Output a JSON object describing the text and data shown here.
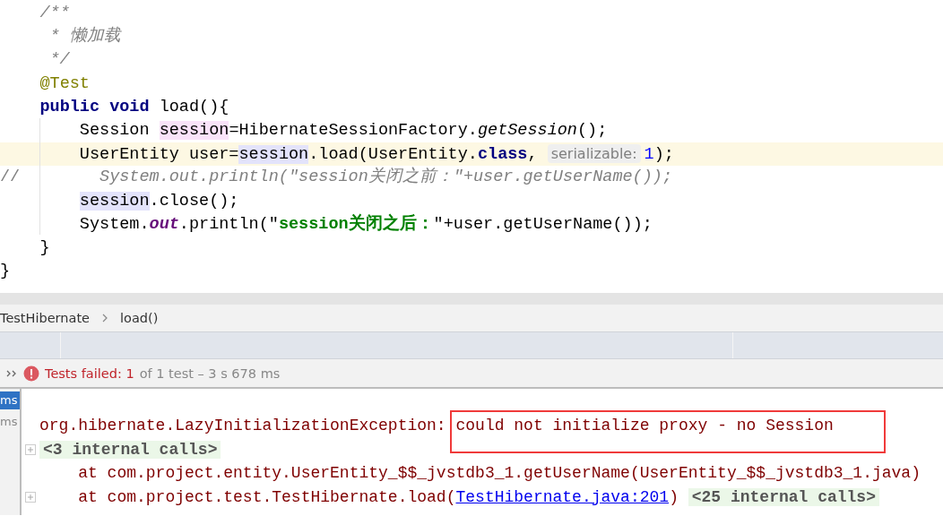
{
  "editor": {
    "lines": [
      {
        "current": false,
        "tokens": [
          {
            "kind": "comment",
            "text": "    /**"
          }
        ]
      },
      {
        "current": false,
        "tokens": [
          {
            "kind": "comment",
            "text": "     * 懒加载"
          }
        ]
      },
      {
        "current": false,
        "tokens": [
          {
            "kind": "comment",
            "text": "     */"
          }
        ]
      },
      {
        "current": false,
        "tokens": [
          {
            "kind": "annotation",
            "text": "    @Test"
          }
        ]
      },
      {
        "current": false,
        "tokens": [
          {
            "kind": "keyword",
            "text": "    public void"
          },
          {
            "kind": "plain",
            "text": " load(){"
          }
        ]
      },
      {
        "current": false,
        "tokens": [
          {
            "kind": "plain",
            "text": "        Session "
          },
          {
            "kind": "write",
            "text": "session"
          },
          {
            "kind": "plain",
            "text": "=HibernateSessionFactory."
          },
          {
            "kind": "static",
            "text": "getSession"
          },
          {
            "kind": "plain",
            "text": "();"
          }
        ]
      },
      {
        "current": true,
        "tokens": [
          {
            "kind": "plain",
            "text": "        UserEntity user="
          },
          {
            "kind": "read",
            "text": "session"
          },
          {
            "kind": "plain",
            "text": ".load(UserEntity."
          },
          {
            "kind": "keyword",
            "text": "class"
          },
          {
            "kind": "plain",
            "text": ", "
          },
          {
            "kind": "hint",
            "text": "serializable:"
          },
          {
            "kind": "number",
            "text": "1"
          },
          {
            "kind": "plain",
            "text": ");"
          }
        ]
      },
      {
        "current": false,
        "tokens": [
          {
            "kind": "comment-plain",
            "text": "//        "
          },
          {
            "kind": "comment",
            "text": "System.out.println(\"session关闭之前：\"+user.getUserName());"
          }
        ]
      },
      {
        "current": false,
        "tokens": [
          {
            "kind": "read",
            "text": "        session"
          },
          {
            "kind": "plain",
            "text": ".close();"
          }
        ]
      },
      {
        "current": false,
        "tokens": [
          {
            "kind": "plain",
            "text": "        System."
          },
          {
            "kind": "field",
            "text": "out"
          },
          {
            "kind": "plain",
            "text": ".println(\""
          },
          {
            "kind": "string",
            "text": "session关闭之后："
          },
          {
            "kind": "plain",
            "text": "\"+user.getUserName());"
          }
        ]
      },
      {
        "current": false,
        "tokens": [
          {
            "kind": "plain",
            "text": "    }"
          }
        ]
      },
      {
        "current": false,
        "tokens": [
          {
            "kind": "plain",
            "text": "}"
          }
        ]
      }
    ]
  },
  "breadcrumb": [
    "TestHibernate",
    "load()"
  ],
  "status": {
    "label": "Tests failed: 1",
    "detail": "of 1 test – 3 s 678 ms"
  },
  "test_tree": [
    {
      "text": "ms",
      "selected": true
    },
    {
      "text": "ms",
      "selected": false
    }
  ],
  "console": {
    "lines": [
      {
        "fold": false,
        "tokens": [
          {
            "kind": "error",
            "text": "org.hibernate.LazyInitializationException: "
          },
          {
            "kind": "boxed",
            "text": "could not initialize proxy - no Session"
          }
        ]
      },
      {
        "fold": true,
        "tokens": [
          {
            "kind": "internal",
            "text": "<3 internal calls>"
          }
        ]
      },
      {
        "fold": false,
        "tokens": [
          {
            "kind": "error",
            "text": "    at com.project.entity.UserEntity_$$_jvstdb3_1.getUserName(UserEntity_$$_jvstdb3_1.java)"
          }
        ]
      },
      {
        "fold": true,
        "tokens": [
          {
            "kind": "error",
            "text": "    at com.project.test.TestHibernate.load("
          },
          {
            "kind": "link",
            "text": "TestHibernate.java:201"
          },
          {
            "kind": "error",
            "text": ") "
          },
          {
            "kind": "internal",
            "text": "<25 internal calls>"
          }
        ]
      }
    ]
  }
}
